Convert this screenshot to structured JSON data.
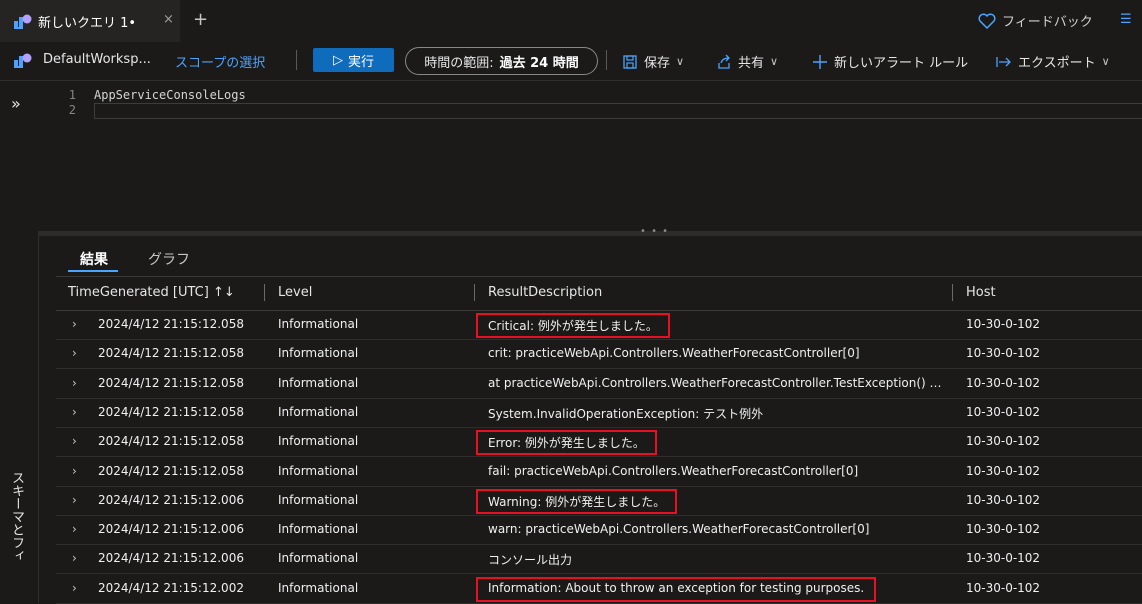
{
  "tab": {
    "title": "新しいクエリ 1•",
    "close": "×",
    "add": "+"
  },
  "feedback": {
    "label": "フィードバック"
  },
  "toolbar": {
    "workspace": "DefaultWorksp...",
    "scope": "スコープの選択",
    "run": "実行",
    "time_label": "時間の範囲:",
    "time_value": "過去 24 時間",
    "save": "保存",
    "share": "共有",
    "new_alert": "新しいアラート ルール",
    "export": "エクスポート"
  },
  "rail": {
    "expand": "»",
    "label": "スキーマとフィ"
  },
  "editor": {
    "lines": [
      {
        "num": "1",
        "text": "AppServiceConsoleLogs"
      },
      {
        "num": "2",
        "text": ""
      }
    ]
  },
  "results": {
    "tabs": [
      "結果",
      "グラフ"
    ],
    "columns": [
      "TimeGenerated [UTC] ↑↓",
      "Level",
      "ResultDescription",
      "Host"
    ],
    "rows": [
      {
        "time": "2024/4/12 21:15:12.058",
        "level": "Informational",
        "desc": "Critical: 例外が発生しました。",
        "host": "10-30-0-102",
        "highlight": true
      },
      {
        "time": "2024/4/12 21:15:12.058",
        "level": "Informational",
        "desc": "crit: practiceWebApi.Controllers.WeatherForecastController[0]",
        "host": "10-30-0-102",
        "highlight": false
      },
      {
        "time": "2024/4/12 21:15:12.058",
        "level": "Informational",
        "desc": "at practiceWebApi.Controllers.WeatherForecastController.TestException() i...",
        "host": "10-30-0-102",
        "highlight": false
      },
      {
        "time": "2024/4/12 21:15:12.058",
        "level": "Informational",
        "desc": "System.InvalidOperationException: テスト例外",
        "host": "10-30-0-102",
        "highlight": false
      },
      {
        "time": "2024/4/12 21:15:12.058",
        "level": "Informational",
        "desc": "Error: 例外が発生しました。",
        "host": "10-30-0-102",
        "highlight": true
      },
      {
        "time": "2024/4/12 21:15:12.058",
        "level": "Informational",
        "desc": "fail: practiceWebApi.Controllers.WeatherForecastController[0]",
        "host": "10-30-0-102",
        "highlight": false
      },
      {
        "time": "2024/4/12 21:15:12.006",
        "level": "Informational",
        "desc": "Warning: 例外が発生しました。",
        "host": "10-30-0-102",
        "highlight": true
      },
      {
        "time": "2024/4/12 21:15:12.006",
        "level": "Informational",
        "desc": "warn: practiceWebApi.Controllers.WeatherForecastController[0]",
        "host": "10-30-0-102",
        "highlight": false
      },
      {
        "time": "2024/4/12 21:15:12.006",
        "level": "Informational",
        "desc": "コンソール出力",
        "host": "10-30-0-102",
        "highlight": false
      },
      {
        "time": "2024/4/12 21:15:12.002",
        "level": "Informational",
        "desc": "Information: About to throw an exception for testing purposes.",
        "host": "10-30-0-102",
        "highlight": true
      }
    ]
  },
  "colors": {
    "accent": "#0f6cbd",
    "link": "#4aa3ff",
    "highlight": "#e81123",
    "background": "#1b1a19"
  },
  "icons": [
    "log-analytics-icon",
    "heart-icon",
    "play-icon",
    "save-icon",
    "share-icon",
    "plus-icon",
    "export-icon",
    "chevron-down-icon",
    "expand-row-icon"
  ]
}
